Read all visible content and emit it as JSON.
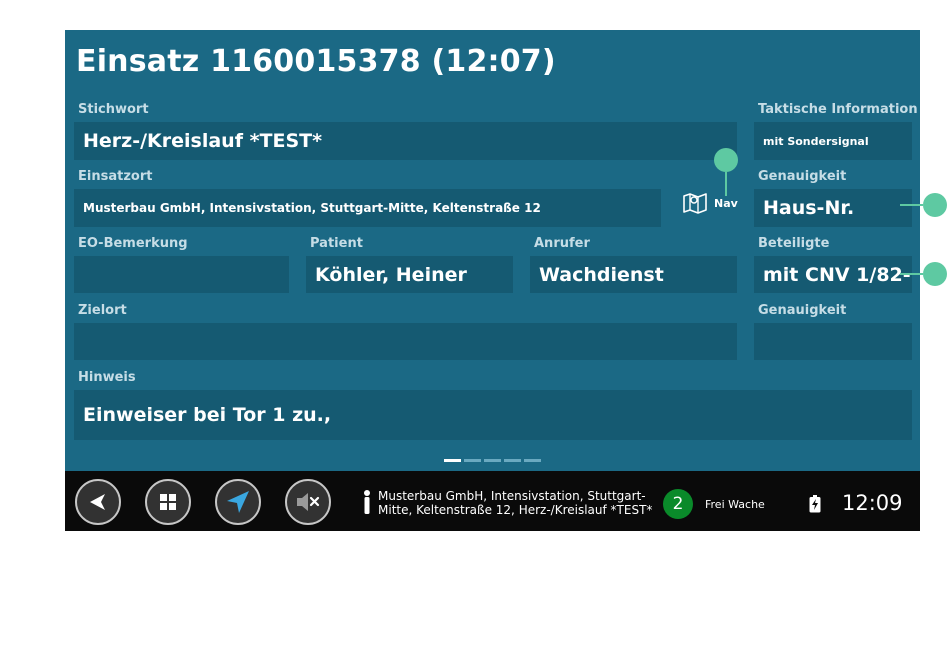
{
  "title": "Einsatz 1160015378 (12:07)",
  "fields": {
    "stichwort": {
      "label": "Stichwort",
      "value": "Herz-/Kreislauf *TEST*"
    },
    "taktische_information": {
      "label": "Taktische Information",
      "value": "mit Sondersignal"
    },
    "einsatzort": {
      "label": "Einsatzort",
      "value": "Musterbau GmbH, Intensivstation, Stuttgart-Mitte, Keltenstraße 12"
    },
    "nav_label": "Nav",
    "genauigkeit_1": {
      "label": "Genauigkeit",
      "value": "Haus-Nr."
    },
    "eo_bemerkung": {
      "label": "EO-Bemerkung",
      "value": ""
    },
    "patient": {
      "label": "Patient",
      "value": "Köhler, Heiner"
    },
    "anrufer": {
      "label": "Anrufer",
      "value": "Wachdienst"
    },
    "beteiligte": {
      "label": "Beteiligte",
      "value": "mit CNV 1/82-1"
    },
    "zielort": {
      "label": "Zielort",
      "value": ""
    },
    "genauigkeit_2": {
      "label": "Genauigkeit",
      "value": ""
    },
    "hinweis": {
      "label": "Hinweis",
      "value": "Einweiser bei Tor 1 zu.,"
    }
  },
  "page_indicator": {
    "total": 5,
    "active": 1
  },
  "bottom_bar": {
    "buttons": [
      {
        "icon": "back-arrow-icon"
      },
      {
        "icon": "apps-grid-icon"
      },
      {
        "icon": "navigation-arrow-icon"
      },
      {
        "icon": "volume-mute-icon"
      }
    ],
    "address_line1": "Musterbau GmbH, Intensivstation, Stuttgart-",
    "address_line2": "Mitte, Keltenstraße 12, Herz-/Kreislauf *TEST*",
    "status_number": "2",
    "status_text": "Frei Wache",
    "time": "12:09"
  },
  "colors": {
    "background": "#1b6985",
    "field": "#155a72",
    "label": "#c6dde6",
    "bar": "#0a0a0a",
    "status_green": "#0a8a2a",
    "callout": "#5ec9a2"
  }
}
